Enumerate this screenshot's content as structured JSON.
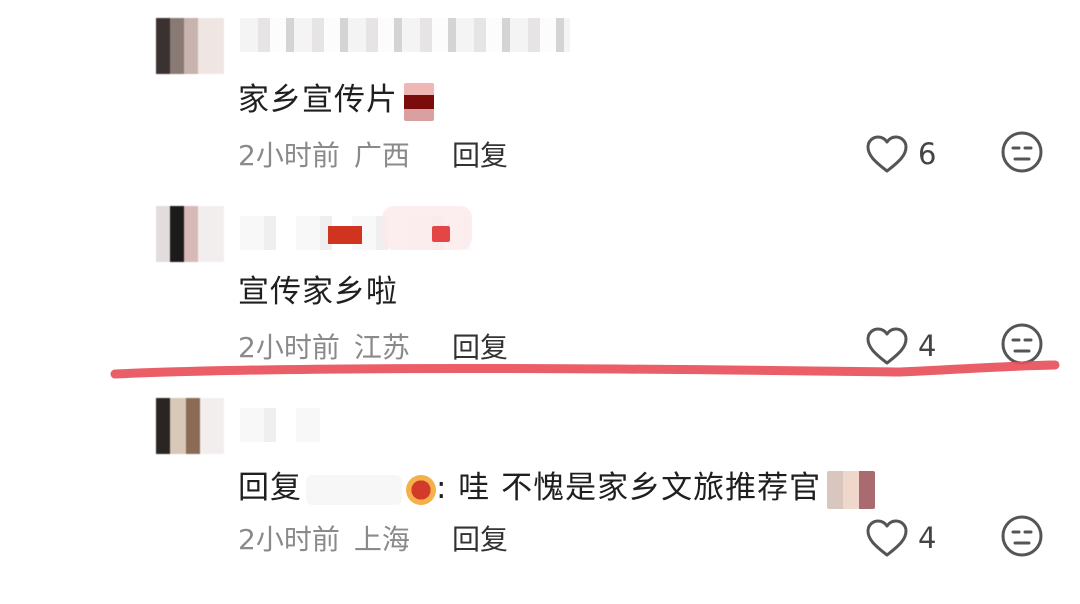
{
  "comments": [
    {
      "text": "家乡宣传片",
      "time": "2小时前",
      "location": "广西",
      "reply_label": "回复",
      "likes": "6"
    },
    {
      "text": "宣传家乡啦",
      "time": "2小时前",
      "location": "江苏",
      "reply_label": "回复",
      "likes": "4"
    },
    {
      "reply_prefix": "回复",
      "text": ": 哇 不愧是家乡文旅推荐官",
      "time": "2小时前",
      "location": "上海",
      "reply_label": "回复",
      "likes": "4"
    }
  ],
  "icons": {
    "like": "heart-outline-icon",
    "dislike": "neutral-face-icon"
  },
  "colors": {
    "annotation_line": "#e8505b",
    "meta_text": "#8a8a8a",
    "main_text": "#1f1f1f"
  }
}
